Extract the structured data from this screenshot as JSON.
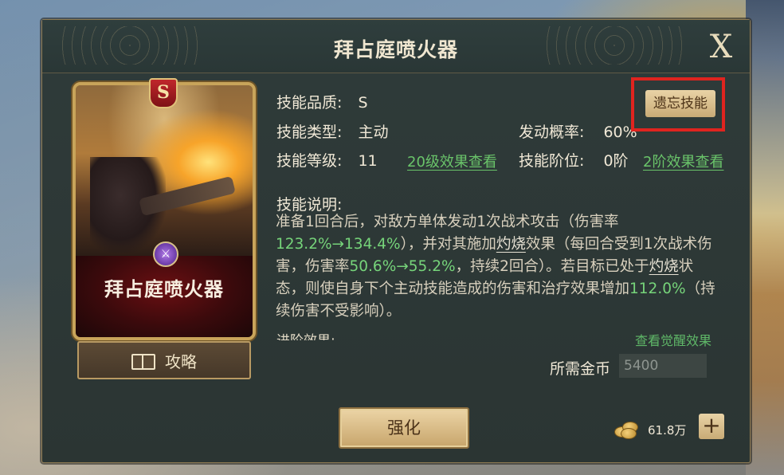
{
  "dialog": {
    "title": "拜占庭喷火器",
    "close_label": "X"
  },
  "card": {
    "grade": "S",
    "name": "拜占庭喷火器",
    "emblem_icon": "crossed-swords-icon"
  },
  "guide_button": {
    "label": "攻略",
    "icon": "book-icon"
  },
  "skill": {
    "quality_label": "技能品质:",
    "quality_value": "S",
    "type_label": "技能类型:",
    "type_value": "主动",
    "level_label": "技能等级:",
    "level_value": "11",
    "level_link": "20级效果查看",
    "chance_label": "发动概率:",
    "chance_value": "60%",
    "rank_label": "技能阶位:",
    "rank_value": "0阶",
    "rank_link": "2阶效果查看"
  },
  "forget_button": {
    "label": "遗忘技能"
  },
  "description": {
    "title": "技能说明:",
    "p1": "准备1回合后，对敌方单体发动1次战术攻击（伤害率",
    "dmg1": "123.2%→134.4%",
    "p2": "），并对其施加",
    "burn1": "灼烧",
    "p3": "效果（每回合受到1次战术伤害，伤害率",
    "dmg2": "50.6%→55.2%",
    "p4": "，持续2回合）。若目标已处于",
    "burn2": "灼烧",
    "p5": "状态，则使自身下个主动技能造成的伤害和治疗效果增加",
    "bonus": "112.0%",
    "p6": "（持续伤害不受影响）。"
  },
  "advance": {
    "title": "进阶效果:",
    "awaken_link": "查看觉醒效果"
  },
  "cost": {
    "label": "所需金币",
    "value": "5400"
  },
  "strengthen_button": {
    "label": "强化"
  },
  "currency": {
    "amount": "61.8万",
    "icon": "gold-coins-icon",
    "plus_label": "+"
  },
  "colors": {
    "highlight_red": "#e0241f",
    "accent_green": "#76d47a",
    "gold_button": "#d9bd8a"
  }
}
